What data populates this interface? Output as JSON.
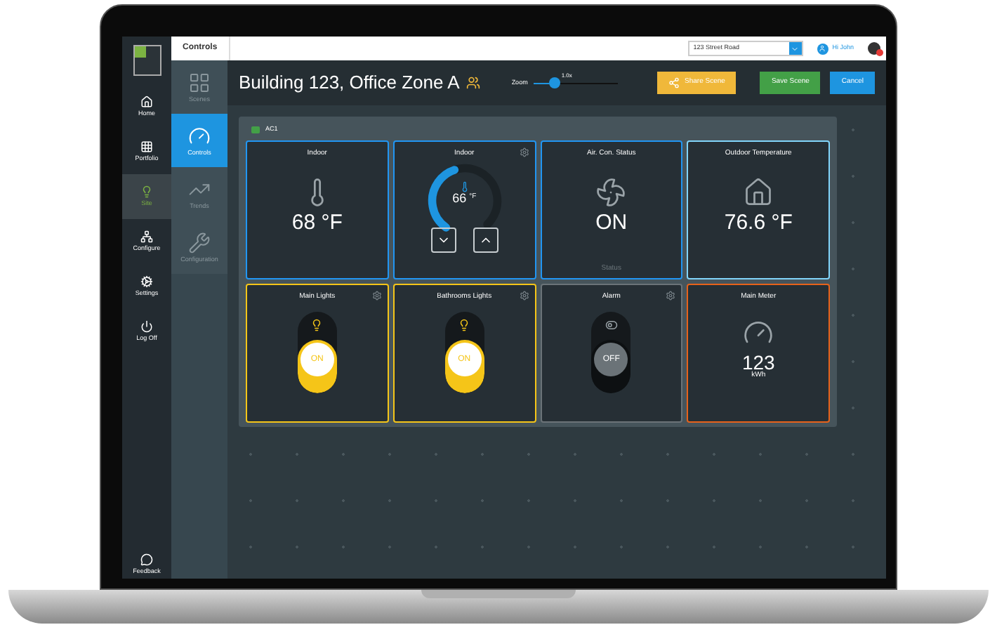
{
  "topbar": {
    "tab": "Controls",
    "location": "123 Street Road",
    "user": "Hi John"
  },
  "nav": [
    {
      "label": "Home",
      "selected": false
    },
    {
      "label": "Portfolio",
      "selected": false
    },
    {
      "label": "Site",
      "selected": true
    },
    {
      "label": "Configure",
      "selected": false
    },
    {
      "label": "Settings",
      "selected": false
    },
    {
      "label": "Log Off",
      "selected": false
    }
  ],
  "feedback": "Feedback",
  "subnav": [
    {
      "label": "Scenes",
      "selected": false
    },
    {
      "label": "Controls",
      "selected": true
    },
    {
      "label": "Trends",
      "selected": false
    },
    {
      "label": "Configuration",
      "selected": false
    }
  ],
  "header": {
    "title": "Building 123, Office Zone A",
    "zoom_label": "Zoom",
    "zoom": {
      "level": 0.25,
      "reading": "1.0x"
    },
    "buttons": [
      {
        "label": "Share Scene",
        "kind": "share"
      },
      {
        "label": "Save Scene",
        "kind": "save"
      },
      {
        "label": "Cancel",
        "kind": "cancel"
      }
    ]
  },
  "panel": {
    "title": "AC1",
    "tiles": [
      {
        "kind": "temperature",
        "title": "Indoor",
        "value": "68 °F",
        "color": "#2196f3",
        "settings": false
      },
      {
        "kind": "thermostat",
        "title": "Indoor",
        "value": "66",
        "unit": "°F",
        "level": 0.45,
        "color": "#2196f3",
        "settings": true
      },
      {
        "kind": "status",
        "title": "Air. Con. Status",
        "value": "ON",
        "caption": "Status",
        "color": "#2196f3",
        "settings": false
      },
      {
        "kind": "outdoor",
        "title": "Outdoor Temperature",
        "value": "76.6 °F",
        "color": "#81d4fa",
        "settings": false
      },
      {
        "kind": "light",
        "title": "Main Lights",
        "switch_label": "ON",
        "on": true,
        "color": "#f5c518",
        "settings": true
      },
      {
        "kind": "light",
        "title": "Bathrooms Lights",
        "switch_label": "ON",
        "on": true,
        "color": "#f5c518",
        "settings": true
      },
      {
        "kind": "alarm",
        "title": "Alarm",
        "switch_label": "OFF",
        "on": false,
        "color": "#6b7378",
        "settings": true
      },
      {
        "kind": "meter",
        "title": "Main Meter",
        "value": "123",
        "unit": "kWh",
        "color": "#e8621a",
        "settings": false
      }
    ]
  }
}
